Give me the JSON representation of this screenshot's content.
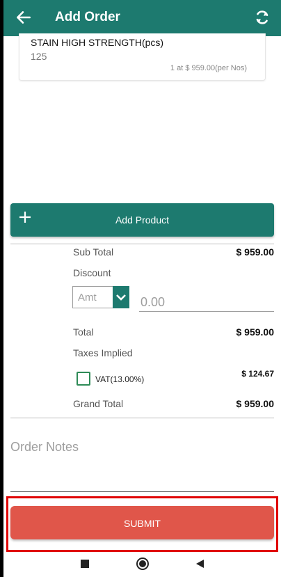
{
  "appbar": {
    "title": "Add Order",
    "back_icon": "arrow-left-icon",
    "sync_icon": "sync-icon"
  },
  "colors": {
    "primary": "#1d7a6f",
    "submit": "#e0564a",
    "highlight_border": "#e00000",
    "checkbox": "#2e8b57"
  },
  "product": {
    "name": "STAIN HIGH STRENGTH(pcs)",
    "quantity": "125",
    "rate_text": "1 at $ 959.00(per Nos)"
  },
  "add_product": {
    "label": "Add Product",
    "icon": "plus-icon"
  },
  "summary": {
    "subtotal_label": "Sub Total",
    "subtotal_value": "$ 959.00",
    "discount_label": "Discount",
    "discount_type": "Amt",
    "discount_placeholder": "0.00",
    "total_label": "Total",
    "total_value": "$ 959.00",
    "taxes_label": "Taxes Implied",
    "vat_label": "VAT(13.00%)",
    "vat_value": "$ 124.67",
    "grand_total_label": "Grand Total",
    "grand_total_value": "$ 959.00"
  },
  "notes": {
    "placeholder": "Order Notes"
  },
  "submit": {
    "label": "SUBMIT"
  },
  "navbar": {
    "recent_icon": "square-icon",
    "home_icon": "circle-home-icon",
    "back_icon": "triangle-back-icon"
  }
}
